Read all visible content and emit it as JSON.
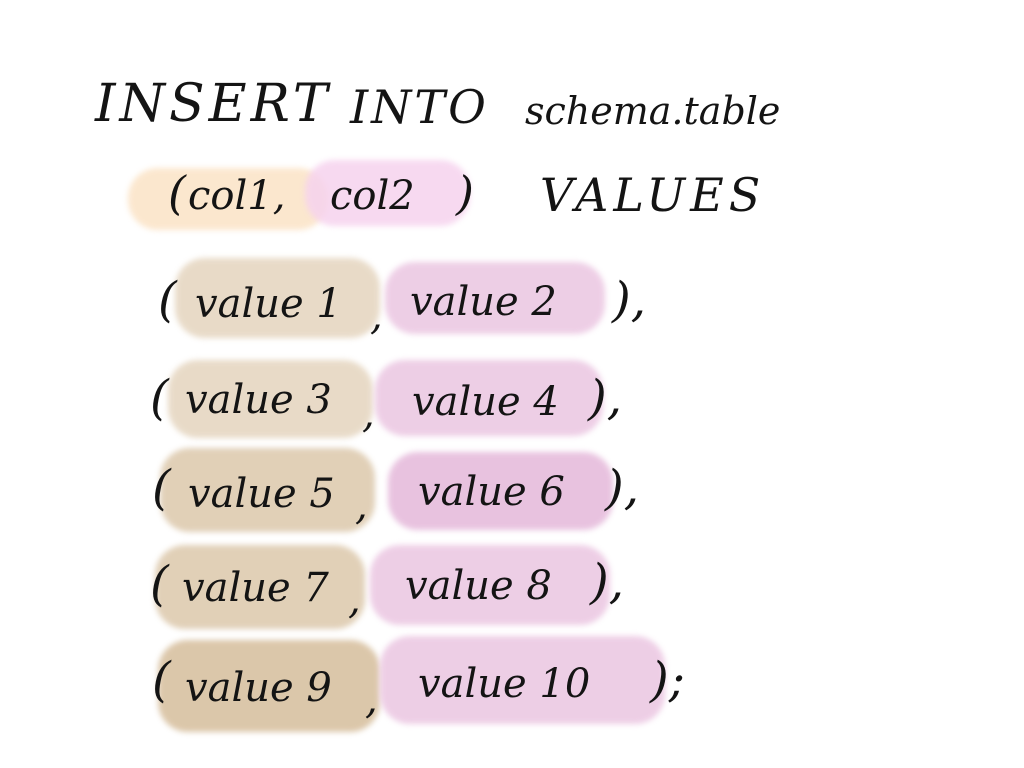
{
  "statement": {
    "insert_kw": "INSERT",
    "into_kw": "INTO",
    "table_name": "schema.table",
    "open_paren": "(",
    "col1": "col1,",
    "col2": "col2",
    "close_paren": ")",
    "values_kw": "VALUES"
  },
  "rows": [
    {
      "open": "(",
      "v1": "value 1",
      "sep": ",",
      "v2": "value 2",
      "close": "),"
    },
    {
      "open": "(",
      "v1": "value 3",
      "sep": ",",
      "v2": "value 4",
      "close": "),"
    },
    {
      "open": "(",
      "v1": "value 5",
      "sep": ",",
      "v2": "value 6",
      "close": "),"
    },
    {
      "open": "(",
      "v1": "value 7",
      "sep": ",",
      "v2": "value 8",
      "close": "),"
    },
    {
      "open": "(",
      "v1": "value 9",
      "sep": ",",
      "v2": "value 10",
      "close": ");"
    }
  ],
  "colors": {
    "ink": "#141414",
    "col1_highlight": "#fbe3c6",
    "col2_highlight": "#f6d3ee",
    "left_value_highlight": "#e6d7c2",
    "right_value_highlight": "#ecc9e3"
  }
}
